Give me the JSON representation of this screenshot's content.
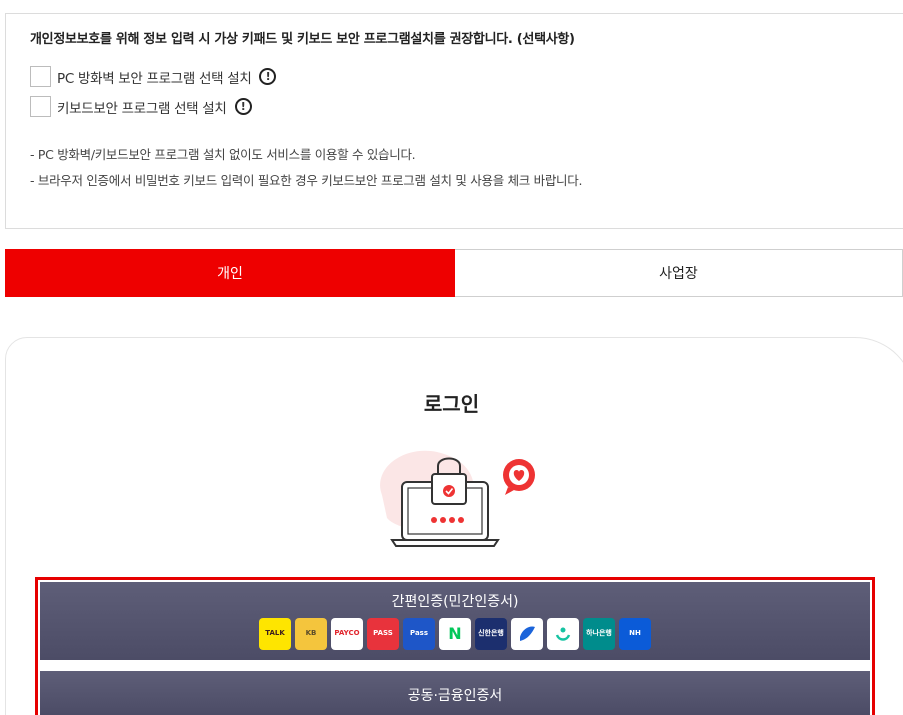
{
  "notice": {
    "title": "개인정보보호를 위해 정보 입력 시 가상 키패드 및 키보드 보안 프로그램설치를 권장합니다. (선택사항)",
    "options": [
      {
        "label": "PC 방화벽 보안 프로그램 선택 설치",
        "checked": false
      },
      {
        "label": "키보드보안 프로그램 선택 설치",
        "checked": false
      }
    ],
    "notes": [
      "- PC 방화벽/키보드보안 프로그램 설치 없이도 서비스를 이용할 수 있습니다.",
      "- 브라우저 인증에서 비밀번호 키보드 입력이 필요한 경우 키보드보안 프로그램 설치 및 사용을 체크 바랍니다."
    ]
  },
  "tabs": [
    {
      "label": "개인",
      "active": true
    },
    {
      "label": "사업장",
      "active": false
    }
  ],
  "login": {
    "title": "로그인"
  },
  "auth": {
    "simple_title": "간편인증(민간인증서)",
    "joint_title": "공동·금융인증서",
    "providers": [
      {
        "name": "kakao-talk",
        "label": "TALK",
        "bg": "#fee500",
        "fg": "#3c1e1e"
      },
      {
        "name": "kb",
        "label": "KB",
        "bg": "#f4c53d",
        "fg": "#5a4a2a"
      },
      {
        "name": "payco",
        "label": "PAYCO",
        "bg": "#ffffff",
        "fg": "#e1242c"
      },
      {
        "name": "pass",
        "label": "PASS",
        "bg": "#e8333c",
        "fg": "#ffffff"
      },
      {
        "name": "samsung-pass",
        "label": "Pass",
        "bg": "#1e56c8",
        "fg": "#ffffff"
      },
      {
        "name": "naver",
        "label": "N",
        "bg": "#ffffff",
        "fg": "#03c75a"
      },
      {
        "name": "shinhan",
        "label": "신한은행",
        "bg": "#1c2f6e",
        "fg": "#ffffff"
      },
      {
        "name": "toss",
        "label": "",
        "bg": "#ffffff",
        "fg": "#1b64da"
      },
      {
        "name": "banksalad",
        "label": "",
        "bg": "#ffffff",
        "fg": "#16c3a2"
      },
      {
        "name": "hana",
        "label": "하나은행",
        "bg": "#008c8c",
        "fg": "#ffffff"
      },
      {
        "name": "nh",
        "label": "NH",
        "bg": "#0b5bd8",
        "fg": "#ffffff"
      }
    ]
  },
  "colors": {
    "accent": "#ee0000",
    "panel": "#5a5a74"
  }
}
